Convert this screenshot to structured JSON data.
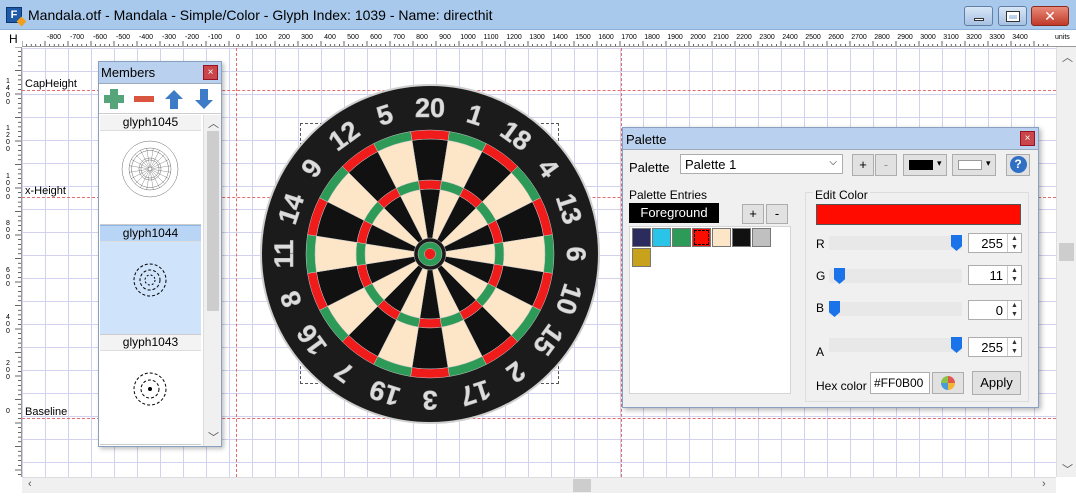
{
  "window": {
    "title": "Mandala.otf - Mandala - Simple/Color - Glyph Index: 1039 - Name: directhit",
    "app_icon": "F"
  },
  "ruler": {
    "corner": "H",
    "ticks": [
      "-800",
      "-700",
      "-600",
      "-500",
      "-400",
      "-300",
      "-200",
      "-100",
      "0",
      "100",
      "200",
      "300",
      "400",
      "500",
      "600",
      "700",
      "800",
      "900",
      "1000",
      "1100",
      "1200",
      "1300",
      "1400",
      "1500",
      "1600",
      "1700",
      "1800",
      "1900",
      "2000",
      "2100",
      "2200",
      "2300",
      "2400",
      "2500",
      "2600",
      "2700",
      "2800",
      "2900",
      "3000",
      "3100",
      "3200",
      "3300",
      "3400"
    ],
    "units": "units",
    "v_ticks": [
      "1400",
      "1200",
      "1000",
      "800",
      "600",
      "400",
      "200",
      "0"
    ]
  },
  "metrics": {
    "cap_height": "CapHeight",
    "x_height": "x-Height",
    "baseline": "Baseline"
  },
  "dartboard": {
    "numbers": [
      "20",
      "1",
      "18",
      "4",
      "13",
      "6",
      "10",
      "15",
      "2",
      "17",
      "3",
      "19",
      "7",
      "16",
      "8",
      "11",
      "14",
      "9",
      "12",
      "5"
    ],
    "colors": {
      "black": "#111111",
      "cream": "#fde6c8",
      "red": "#f01b1b",
      "green": "#2e9a57",
      "rim": "#1b1b1b"
    }
  },
  "members": {
    "title": "Members",
    "close": "×",
    "tools": {
      "add": "plus-icon",
      "remove": "minus-icon",
      "up": "arrow-up-icon",
      "down": "arrow-down-icon"
    },
    "glyphs": [
      {
        "name": "glyph1045"
      },
      {
        "name": "glyph1044"
      },
      {
        "name": "glyph1043"
      }
    ]
  },
  "palette": {
    "title": "Palette",
    "close": "×",
    "palette_label": "Palette",
    "palette_value": "Palette 1",
    "plus": "+",
    "minus": "-",
    "help": "?",
    "entries_label": "Palette Entries",
    "foreground": "Foreground",
    "entry_add": "+",
    "entry_remove": "-",
    "swatches": [
      "#2b2b5e",
      "#2ac4e8",
      "#2e9a57",
      "#ff0b00",
      "#fde6c8",
      "#111111",
      "#c0c0c0",
      "#c8a21a"
    ],
    "edit_color_label": "Edit Color",
    "current_color": "#ff0b00",
    "r_label": "R",
    "r": "255",
    "g_label": "G",
    "g": "11",
    "b_label": "B",
    "b": "0",
    "a_label": "A",
    "a": "255",
    "hex_label": "Hex color",
    "hex_value": "#FF0B00",
    "apply": "Apply"
  }
}
